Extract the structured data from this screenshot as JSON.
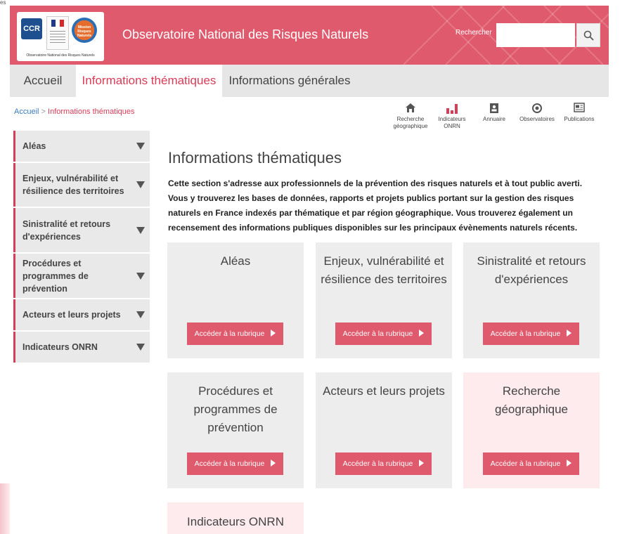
{
  "corner_text": "es",
  "header": {
    "logo_ccr": "CCR",
    "logo_mrn": "Mission Risques Naturels",
    "logo_caption": "Observatoire National des Risques Naturels",
    "title": "Observatoire National des Risques Naturels",
    "search_label": "Rechercher",
    "search_value": "",
    "search_icon": "magnifier-icon"
  },
  "nav": [
    {
      "label": "Accueil"
    },
    {
      "label": "Informations thématiques",
      "active": true
    },
    {
      "label": "Informations générales"
    }
  ],
  "breadcrumb": {
    "home": "Accueil",
    "separator": ">",
    "current": "Informations thématiques"
  },
  "quick_links": [
    {
      "line1": "Recherche",
      "line2": "géographique",
      "icon": "home-map-icon"
    },
    {
      "line1": "Indicateurs",
      "line2": "ONRN",
      "icon": "bar-chart-icon"
    },
    {
      "line1": "Annuaire",
      "line2": "",
      "icon": "address-book-icon"
    },
    {
      "line1": "Observatoires",
      "line2": "",
      "icon": "eye-icon"
    },
    {
      "line1": "Publications",
      "line2": "",
      "icon": "newspaper-icon"
    }
  ],
  "sidebar": [
    {
      "label": "Aléas"
    },
    {
      "label": "Enjeux, vulnérabilité et résilience des territoires"
    },
    {
      "label": "Sinistralité et retours d'expériences"
    },
    {
      "label": "Procédures et programmes de prévention"
    },
    {
      "label": "Acteurs et leurs projets"
    },
    {
      "label": "Indicateurs ONRN"
    }
  ],
  "main": {
    "title": "Informations thématiques",
    "intro": "Cette section s'adresse aux professionnels de la prévention des risques naturels et à tout public averti. Vous y trouverez les bases de données, rapports et projets publics portant sur la gestion des risques naturels en France indexés par thématique et par région géographique. Vous trouverez également un recensement des informations publiques disponibles sur les principaux évènements naturels récents."
  },
  "cards": [
    {
      "title": "Aléas",
      "button": "Accéder à la rubrique"
    },
    {
      "title": "Enjeux, vulnérabilité et résilience des territoires",
      "button": "Accéder à la rubrique"
    },
    {
      "title": "Sinistralité et retours d'expériences",
      "button": "Accéder à la rubrique"
    },
    {
      "title": "Procédures et programmes de prévention",
      "button": "Accéder à la rubrique"
    },
    {
      "title": "Acteurs et leurs projets",
      "button": "Accéder à la rubrique"
    },
    {
      "title": "Recherche géographique",
      "button": "Accéder à la rubrique"
    },
    {
      "title": "Indicateurs ONRN",
      "button": ""
    }
  ],
  "colors": {
    "accent": "#e05a6d",
    "active_text": "#d83c56",
    "card_gray": "#ededed",
    "card_pink": "#fdebed"
  }
}
